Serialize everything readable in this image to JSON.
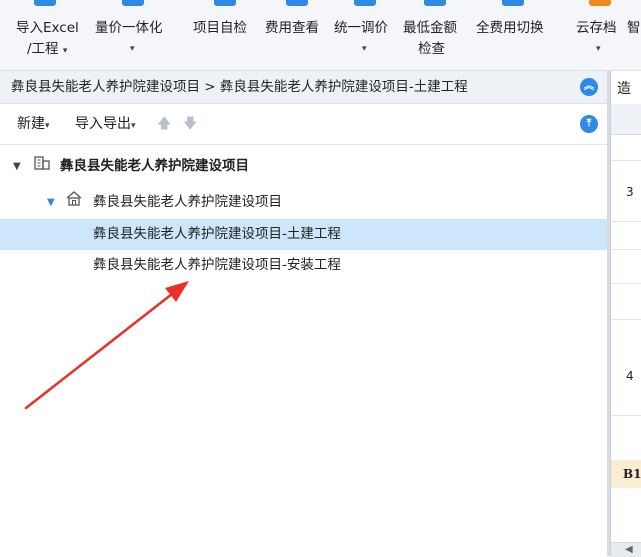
{
  "toolbar": {
    "items": [
      {
        "line1": "导入Excel",
        "line2": "/工程",
        "caret": "▾"
      },
      {
        "line1": "量价一体化",
        "line2": "",
        "caret": "▾"
      },
      {
        "line1": "项目自检",
        "line2": ""
      },
      {
        "line1": "费用查看",
        "line2": ""
      },
      {
        "line1": "统一调价",
        "line2": "",
        "caret": "▾"
      },
      {
        "line1": "最低金额",
        "line2": "检查"
      },
      {
        "line1": "全费用切换",
        "line2": ""
      },
      {
        "line1": "云存档",
        "line2": "",
        "caret": "▾"
      },
      {
        "line1": "智",
        "line2": ""
      }
    ]
  },
  "breadcrumb": {
    "path": "彝良县失能老人养护院建设项目 > 彝良县失能老人养护院建设项目-土建工程",
    "collapse_icon": "double-chevron-up"
  },
  "project_toolbar": {
    "new_label": "新建",
    "import_export_label": "导入导出",
    "up_icon": "arrow-up",
    "down_icon": "arrow-down",
    "pin_icon": "pin"
  },
  "tree": {
    "root": {
      "label": "彝良县失能老人养护院建设项目",
      "expander": "▼",
      "icon": "building"
    },
    "single": {
      "label": "彝良县失能老人养护院建设项目",
      "expander": "▼",
      "icon": "house"
    },
    "units": [
      {
        "label": "彝良县失能老人养护院建设项目-土建工程",
        "selected": true
      },
      {
        "label": "彝良县失能老人养护院建设项目-安装工程",
        "selected": false
      }
    ]
  },
  "right_pane": {
    "tab_label": "造",
    "row_numbers": [
      "3",
      "4"
    ],
    "b1_label": "B1"
  },
  "colors": {
    "accent": "#2f8ae5",
    "selection": "#cde6fb",
    "annotation": "#e8312a"
  }
}
